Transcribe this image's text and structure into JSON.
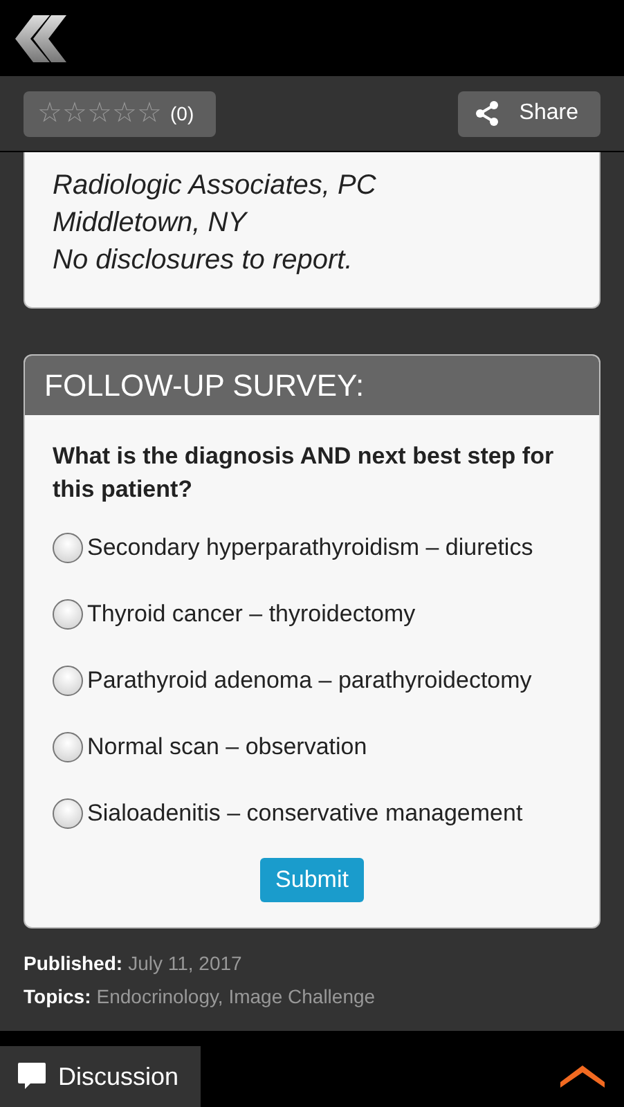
{
  "rating": {
    "stars": 0,
    "count": "(0)"
  },
  "share_button": "Share",
  "author_lines": [
    "Radiologic Associates, PC",
    "Middletown, NY",
    "No disclosures to report."
  ],
  "survey": {
    "title": "FOLLOW-UP SURVEY:",
    "question": "What is the diagnosis AND next best step for this patient?",
    "options": [
      {
        "label": "Secondary hyperparathyroidism – diuretics",
        "selected": false
      },
      {
        "label": "Thyroid cancer – thyroidectomy",
        "selected": false
      },
      {
        "label": "Parathyroid adenoma – parathyroidectomy",
        "selected": false
      },
      {
        "label": "Normal scan – observation",
        "selected": false
      },
      {
        "label": "Sialoadenitis – conservative management",
        "selected": false
      }
    ],
    "submit": "Submit"
  },
  "meta": [
    {
      "label": "Published:",
      "value": "July 11, 2017"
    },
    {
      "label": "Topics:",
      "value": "Endocrinology, Image Challenge"
    }
  ],
  "footer": {
    "discussion": "Discussion"
  }
}
